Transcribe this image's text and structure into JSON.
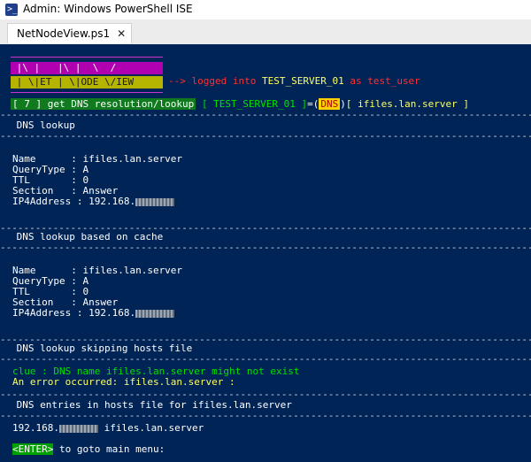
{
  "window": {
    "title": "Admin: Windows PowerShell ISE"
  },
  "tab": {
    "label": "NetNodeView.ps1"
  },
  "banner": {
    "line1": " |\\ |   |\\ |  \\  / ",
    "line2": " | \\|ET | \\|ODE \\/IEW",
    "arrow": "-->",
    "logged": "logged into",
    "server": "TEST_SERVER_01",
    "as": "as",
    "user": "test_user"
  },
  "command": {
    "step": "[ 7 ] get DNS resolution/lookup",
    "server": "[ TEST_SERVER_01 ]",
    "eq": "=(",
    "dns": "DNS",
    "close": ")",
    "target": "[ ifiles.lan.server ]"
  },
  "dash": "-----------------------------------------------------------------------------------------------",
  "sections": {
    "lookup": {
      "header": " DNS lookup"
    },
    "cache": {
      "header": " DNS lookup based on cache"
    },
    "skip": {
      "header": " DNS lookup skipping hosts file"
    },
    "hosts": {
      "header": " DNS entries in hosts file for ifiles.lan.server"
    }
  },
  "record": {
    "name_line": "Name      : ifiles.lan.server",
    "type_line": "QueryType : A",
    "ttl_line": "TTL       : 0",
    "section_line": "Section   : Answer",
    "ip_label": "IP4Address : 192.168."
  },
  "errors": {
    "clue": "clue : DNS name ifiles.lan.server might not exist",
    "error": "An error occurred: ifiles.lan.server :"
  },
  "hosts_entry": {
    "prefix": "192.168.",
    "host": " ifiles.lan.server"
  },
  "footer": {
    "key": "<ENTER>",
    "text": " to goto main menu:"
  }
}
